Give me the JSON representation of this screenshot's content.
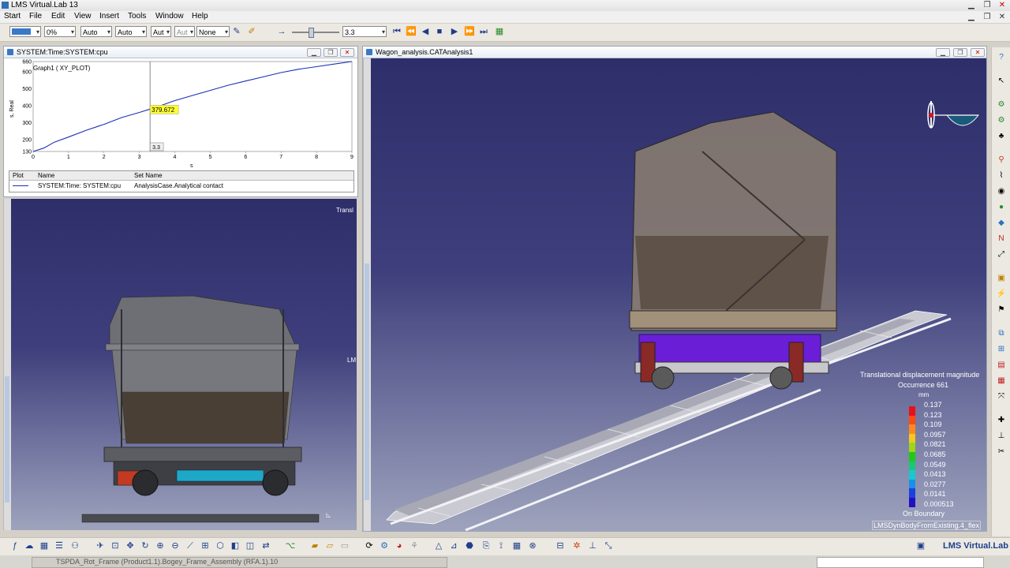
{
  "app": {
    "title": "LMS Virtual.Lab 13"
  },
  "menu": [
    "Start",
    "File",
    "Edit",
    "View",
    "Insert",
    "Tools",
    "Window",
    "Help"
  ],
  "toolbar": {
    "percent": "0%",
    "auto1": "Auto",
    "auto2": "Auto",
    "aut3": "Aut",
    "aut4": "Aut",
    "none": "None",
    "time": "3.3"
  },
  "graph_panel": {
    "title": "SYSTEM:Time:SYSTEM:cpu",
    "graph_name": "Graph1 ( XY_PLOT)",
    "ylabel": "s, Real",
    "xlabel": "s",
    "cursor_value": "379.672",
    "cursor_x_label": "3.3",
    "table_headers": [
      "Plot",
      "Name",
      "Set Name"
    ],
    "table_row": {
      "name": "SYSTEM:Time: SYSTEM:cpu",
      "set": "AnalysisCase.Analytical contact"
    }
  },
  "chart_data": {
    "type": "line",
    "title": "Graph1 ( XY_PLOT)",
    "xlabel": "s",
    "ylabel": "s, Real",
    "xlim": [
      0,
      9
    ],
    "ylim": [
      130,
      660
    ],
    "xticks": [
      "0",
      "1",
      "2",
      "3",
      "4",
      "5",
      "6",
      "7",
      "8",
      "9"
    ],
    "yticks": [
      "130",
      "200",
      "300",
      "400",
      "500",
      "600",
      "660"
    ],
    "x": [
      0,
      0.3,
      0.6,
      1,
      1.5,
      2,
      2.5,
      3,
      3.3,
      3.6,
      4,
      4.5,
      5,
      5.5,
      6,
      6.5,
      7,
      7.5,
      8,
      8.5,
      9
    ],
    "y": [
      130,
      150,
      185,
      215,
      255,
      290,
      330,
      360,
      379.672,
      400,
      430,
      460,
      490,
      520,
      545,
      570,
      595,
      615,
      630,
      645,
      660
    ]
  },
  "left_view": {
    "partial_label_top": "Transl",
    "partial_label_mid": "LM"
  },
  "main_view": {
    "title": "Wagon_analysis.CATAnalysis1",
    "legend": {
      "title": "Translational displacement magnitude",
      "occurrence": "Occurrence 661",
      "unit": "mm",
      "values": [
        "0.137",
        "0.123",
        "0.109",
        "0.0957",
        "0.0821",
        "0.0685",
        "0.0549",
        "0.0413",
        "0.0277",
        "0.0141",
        "0.000513"
      ],
      "colors": [
        "#e8101a",
        "#ff4a14",
        "#ff8a1a",
        "#f5c81a",
        "#9cd818",
        "#22c818",
        "#18c878",
        "#18c8d0",
        "#1a90e8",
        "#1a40e0",
        "#2010c0"
      ],
      "footer1": "On Boundary",
      "footer2": "LMSDynBodyFromExisting.4_flex"
    }
  },
  "status": {
    "brand": "LMS Virtual.Lab"
  },
  "taskbar": {
    "item": "TSPDA_Rot_Frame (Product1.1).Bogey_Frame_Assembly (RFA.1).10"
  }
}
